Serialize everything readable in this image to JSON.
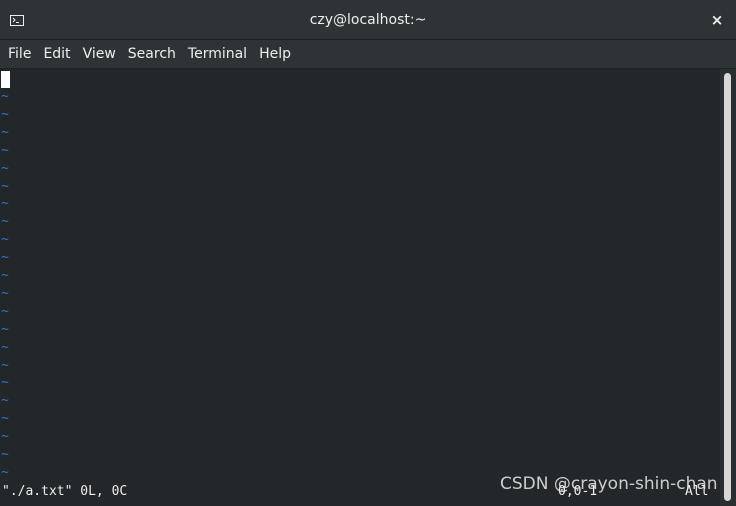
{
  "window": {
    "title": "czy@localhost:~",
    "close_label": "×"
  },
  "menubar": {
    "items": [
      "File",
      "Edit",
      "View",
      "Search",
      "Terminal",
      "Help"
    ]
  },
  "terminal": {
    "tilde": "~",
    "tilde_count": 22,
    "status": "\"./a.txt\" 0L, 0C",
    "ruler": "0,0-1",
    "position": "All",
    "watermark": "CSDN @crayon-shin-chan",
    "colors": {
      "background": "#232729",
      "tilde": "#3d6fbf",
      "text": "#eeeeec",
      "cursor": "#ffffff"
    }
  }
}
